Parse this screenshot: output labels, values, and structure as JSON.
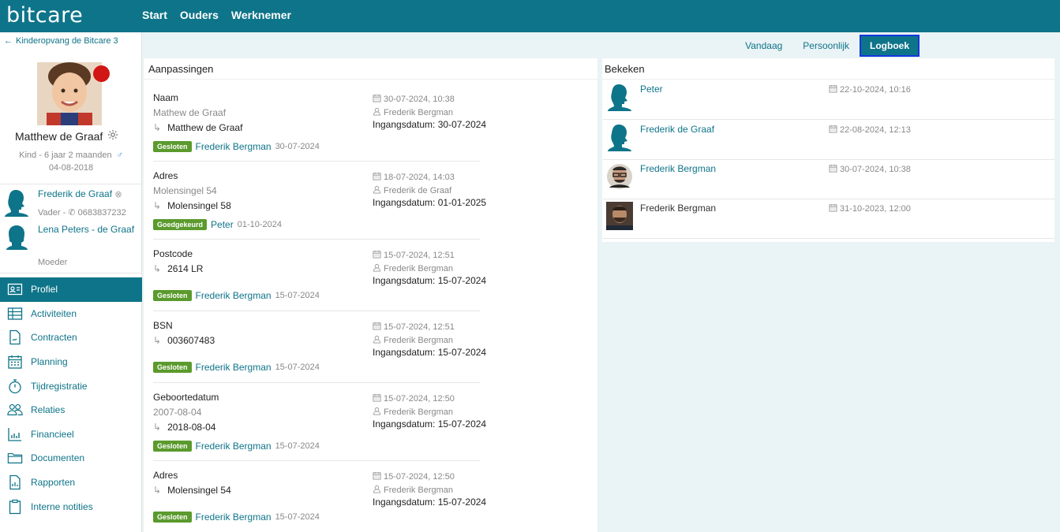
{
  "app": {
    "logo": "bitcare"
  },
  "topnav": [
    "Start",
    "Ouders",
    "Werknemer"
  ],
  "sidebar": {
    "back_label": "Kinderopvang de Bitcare 3",
    "child": {
      "name": "Matthew de Graaf",
      "meta": "Kind - 6 jaar 2 maanden",
      "birthdate": "04-08-2018"
    },
    "parents": [
      {
        "name": "Frederik de Graaf",
        "role": "Vader -",
        "phone": "0683837232"
      },
      {
        "name": "Lena Peters - de Graaf",
        "role": "Moeder"
      }
    ],
    "menu": [
      {
        "label": "Profiel",
        "icon": "profile-card-icon",
        "active": true
      },
      {
        "label": "Activiteiten",
        "icon": "table-icon"
      },
      {
        "label": "Contracten",
        "icon": "contract-icon"
      },
      {
        "label": "Planning",
        "icon": "calendar-icon"
      },
      {
        "label": "Tijdregistratie",
        "icon": "stopwatch-icon"
      },
      {
        "label": "Relaties",
        "icon": "people-icon"
      },
      {
        "label": "Financieel",
        "icon": "bar-chart-icon"
      },
      {
        "label": "Documenten",
        "icon": "folder-icon"
      },
      {
        "label": "Rapporten",
        "icon": "report-icon"
      },
      {
        "label": "Interne notities",
        "icon": "clipboard-icon"
      }
    ]
  },
  "tabs": [
    "Vandaag",
    "Persoonlijk",
    "Logboek"
  ],
  "changes": {
    "title": "Aanpassingen",
    "entries": [
      {
        "field": "Naam",
        "old": "Mathew de Graaf",
        "new": "Matthew de Graaf",
        "date": "30-07-2024, 10:38",
        "by": "Frederik Bergman",
        "ingang": "Ingangsdatum: 30-07-2024",
        "status": "Gesloten",
        "who": "Frederik Bergman",
        "when": "30-07-2024"
      },
      {
        "field": "Adres",
        "old": "Molensingel 54",
        "new": "Molensingel 58",
        "date": "18-07-2024, 14:03",
        "by": "Frederik de Graaf",
        "ingang": "Ingangsdatum: 01-01-2025",
        "status": "Goedgekeurd",
        "who": "Peter",
        "when": "01-10-2024"
      },
      {
        "field": "Postcode",
        "old": "",
        "new": "2614 LR",
        "date": "15-07-2024, 12:51",
        "by": "Frederik Bergman",
        "ingang": "Ingangsdatum: 15-07-2024",
        "status": "Gesloten",
        "who": "Frederik Bergman",
        "when": "15-07-2024"
      },
      {
        "field": "BSN",
        "old": "",
        "new": "003607483",
        "date": "15-07-2024, 12:51",
        "by": "Frederik Bergman",
        "ingang": "Ingangsdatum: 15-07-2024",
        "status": "Gesloten",
        "who": "Frederik Bergman",
        "when": "15-07-2024"
      },
      {
        "field": "Geboortedatum",
        "old": "2007-08-04",
        "new": "2018-08-04",
        "date": "15-07-2024, 12:50",
        "by": "Frederik Bergman",
        "ingang": "Ingangsdatum: 15-07-2024",
        "status": "Gesloten",
        "who": "Frederik Bergman",
        "when": "15-07-2024"
      },
      {
        "field": "Adres",
        "old": "",
        "new": "Molensingel 54",
        "date": "15-07-2024, 12:50",
        "by": "Frederik Bergman",
        "ingang": "Ingangsdatum: 15-07-2024",
        "status": "Gesloten",
        "who": "Frederik Bergman",
        "when": "15-07-2024"
      }
    ]
  },
  "viewed": {
    "title": "Bekeken",
    "rows": [
      {
        "name": "Peter",
        "date": "22-10-2024, 10:16",
        "avatar": "silhouette"
      },
      {
        "name": "Frederik de Graaf",
        "date": "22-08-2024, 12:13",
        "avatar": "silhouette"
      },
      {
        "name": "Frederik Bergman",
        "date": "30-07-2024, 10:38",
        "avatar": "photo-round"
      },
      {
        "name": "Frederik Bergman",
        "date": "31-10-2023, 12:00",
        "avatar": "photo-square"
      }
    ]
  },
  "colors": {
    "brand": "#0e7489",
    "status_red": "#d11616",
    "badge_green": "#5b9a2d",
    "tab_focus": "#1436e0"
  }
}
